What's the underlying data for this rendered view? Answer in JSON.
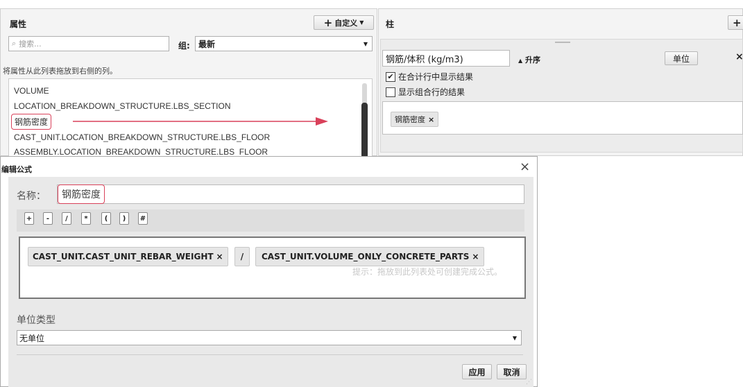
{
  "left": {
    "title": "属性",
    "custom_button": "自定义",
    "search_placeholder": "搜索...",
    "group_label": "组:",
    "group_value": "最新",
    "hint": "将属性从此列表拖放到右侧的列。",
    "items": [
      "VOLUME",
      "LOCATION_BREAKDOWN_STRUCTURE.LBS_SECTION",
      "钢筋密度",
      "CAST_UNIT.LOCATION_BREAKDOWN_STRUCTURE.LBS_FLOOR",
      "ASSEMBLY.LOCATION_BREAKDOWN_STRUCTURE.LBS_FLOOR"
    ]
  },
  "right": {
    "title": "柱",
    "column_name": "钢筋/体积 (kg/m3)",
    "sort_label": "升序",
    "unit_button": "单位",
    "close": "×",
    "show_in_total": "在合计行中显示结果",
    "show_combined": "显示组合行的结果",
    "chip": "钢筋密度"
  },
  "dialog": {
    "title": "编辑公式",
    "name_label": "名称：",
    "name_value": "钢筋密度",
    "operators": [
      "+",
      "-",
      "/",
      "*",
      "(",
      ")",
      "#"
    ],
    "formula_left": "CAST_UNIT.CAST_UNIT_REBAR_WEIGHT",
    "formula_op": "/",
    "formula_right": "CAST_UNIT.VOLUME_ONLY_CONCRETE_PARTS",
    "hint_text": "提示：拖放到此列表处可创建完成公式。",
    "unit_type_label": "单位类型",
    "unit_type_value": "无单位",
    "apply": "应用",
    "cancel": "取消"
  },
  "colors": {
    "accent": "#d9415a",
    "bg_gray": "#e9e9e9"
  }
}
